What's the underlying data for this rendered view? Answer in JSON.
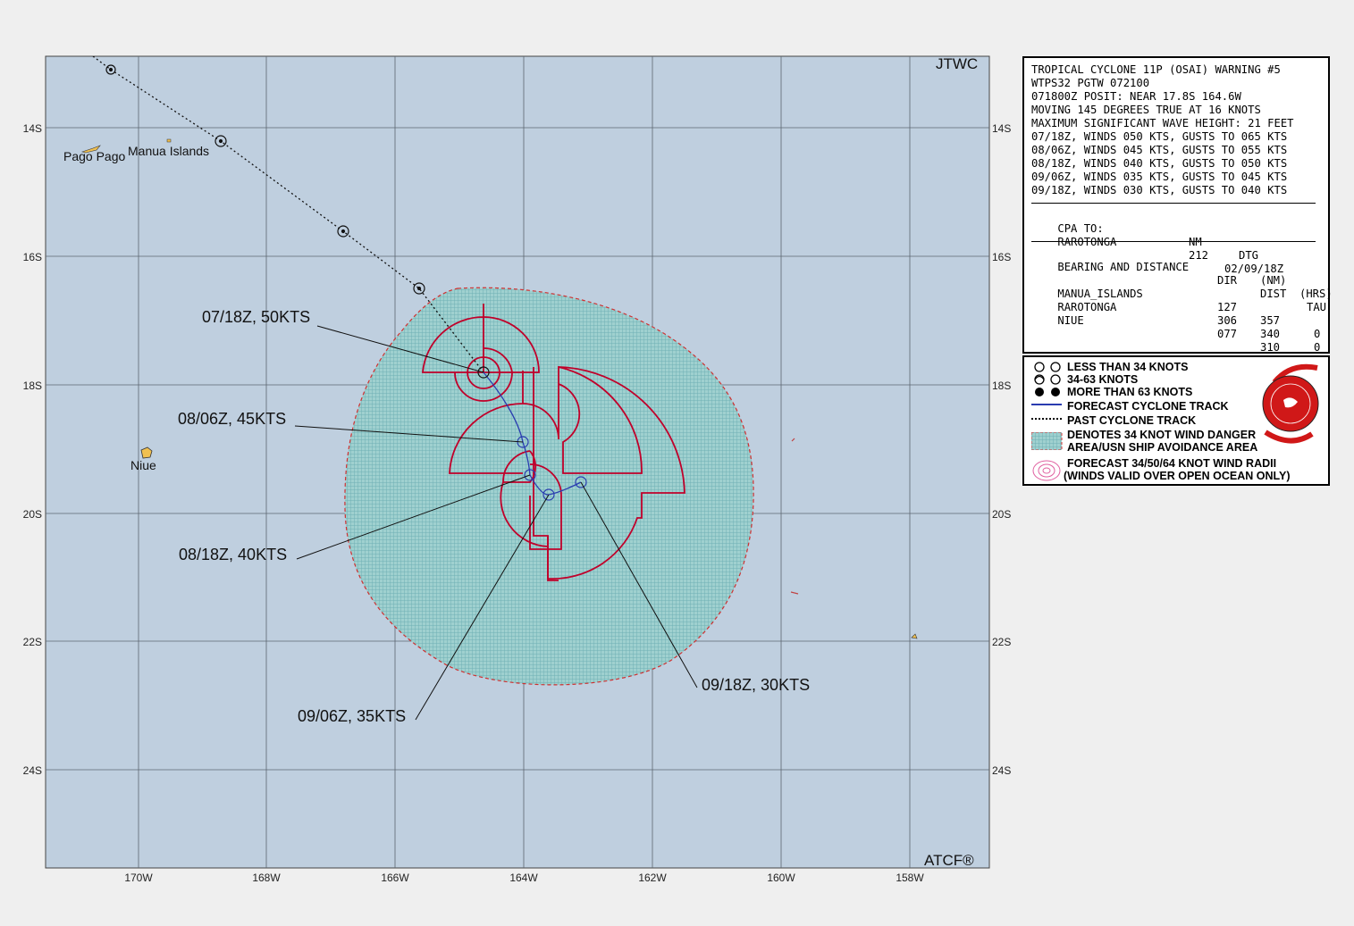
{
  "map": {
    "agency": "JTWC",
    "footer": "ATCF®",
    "lon_ticks": [
      "170W",
      "168W",
      "166W",
      "164W",
      "162W",
      "160W",
      "158W"
    ],
    "lat_ticks": [
      "14S",
      "16S",
      "18S",
      "20S",
      "22S",
      "24S"
    ],
    "places": [
      "Pago Pago",
      "Manua Islands",
      "Niue"
    ],
    "forecast_labels": [
      "07/18Z, 50KTS",
      "08/06Z, 45KTS",
      "08/18Z, 40KTS",
      "09/06Z, 35KTS",
      "09/18Z, 30KTS"
    ],
    "colors": {
      "ocean": "#bfcfdf",
      "danger_area": "#8fc6c9",
      "wind_radii": "#c0002a",
      "forecast_track": "#2a3cb0",
      "grid": "#555555"
    }
  },
  "warning": {
    "lines": [
      "TROPICAL CYCLONE 11P (OSAI) WARNING #5",
      "WTPS32 PGTW 072100",
      "071800Z POSIT: NEAR 17.8S 164.6W",
      "MOVING 145 DEGREES TRUE AT 16 KNOTS",
      "MAXIMUM SIGNIFICANT WAVE HEIGHT: 21 FEET",
      "07/18Z, WINDS 050 KTS, GUSTS TO 065 KTS",
      "08/06Z, WINDS 045 KTS, GUSTS TO 055 KTS",
      "08/18Z, WINDS 040 KTS, GUSTS TO 050 KTS",
      "09/06Z, WINDS 035 KTS, GUSTS TO 045 KTS",
      "09/18Z, WINDS 030 KTS, GUSTS TO 040 KTS"
    ],
    "cpa": {
      "title": "CPA TO:",
      "h_nm": "NM",
      "h_dtg": "DTG",
      "place": "RAROTONGA",
      "nm": "212",
      "dtg": "02/09/18Z"
    },
    "bearing": {
      "title": "BEARING AND DISTANCE",
      "h_dir": "DIR",
      "h_dist": "DIST",
      "h_tau": "TAU",
      "h_nm": "(NM)",
      "h_hrs": "(HRS)",
      "rows": [
        {
          "place": "MANUA_ISLANDS",
          "dir": "127",
          "dist": "357",
          "tau": "0"
        },
        {
          "place": "RAROTONGA",
          "dir": "306",
          "dist": "340",
          "tau": "0"
        },
        {
          "place": "NIUE",
          "dir": "077",
          "dist": "310",
          "tau": "0"
        }
      ]
    }
  },
  "legend": {
    "items": [
      "LESS THAN 34 KNOTS",
      "34-63 KNOTS",
      "MORE THAN 63 KNOTS",
      "FORECAST CYCLONE TRACK",
      "PAST CYCLONE TRACK",
      "DENOTES 34 KNOT WIND DANGER",
      "AREA/USN SHIP AVOIDANCE AREA",
      "FORECAST 34/50/64 KNOT WIND RADII",
      "(WINDS VALID OVER OPEN OCEAN ONLY)"
    ]
  }
}
